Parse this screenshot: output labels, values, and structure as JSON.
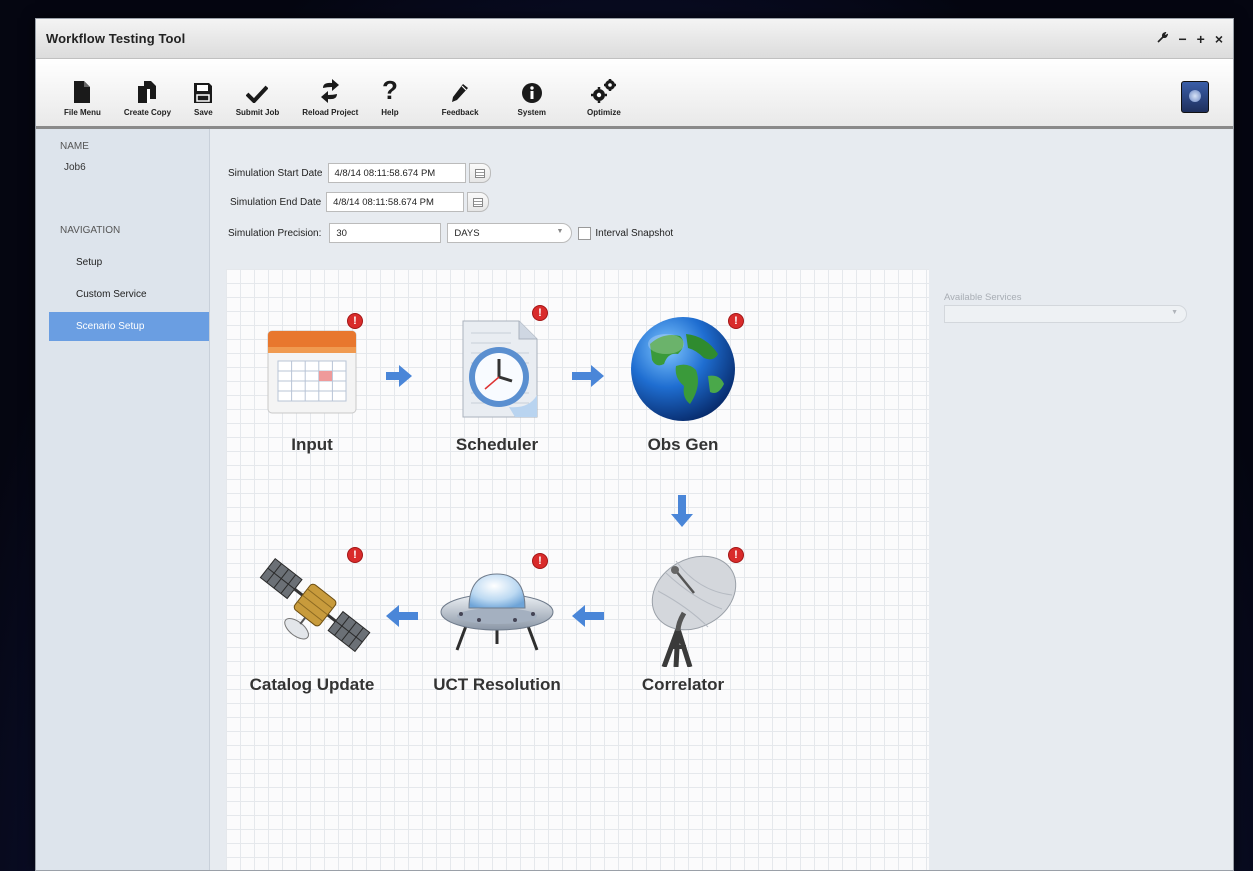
{
  "window": {
    "title": "Workflow Testing Tool",
    "controls": [
      "⁄",
      "−",
      "+",
      "×"
    ]
  },
  "toolbar": {
    "items": [
      {
        "label": "File Menu",
        "icon": "file-icon"
      },
      {
        "label": "Create Copy",
        "icon": "copy-icon"
      },
      {
        "label": "Save",
        "icon": "save-icon"
      },
      {
        "label": "Submit Job",
        "icon": "checkmark-icon"
      },
      {
        "label": "Reload Project",
        "icon": "reload-icon"
      },
      {
        "label": "Help",
        "icon": "help-icon"
      },
      {
        "label": "Feedback",
        "icon": "pencil-icon"
      },
      {
        "label": "System",
        "icon": "info-icon"
      },
      {
        "label": "Optimize",
        "icon": "gears-icon"
      }
    ]
  },
  "sidebar": {
    "name_heading": "NAME",
    "name_value": "Job6",
    "nav_heading": "NAVIGATION",
    "items": [
      {
        "label": "Setup"
      },
      {
        "label": "Custom Service"
      },
      {
        "label": "Scenario Setup"
      }
    ]
  },
  "form": {
    "start_label": "Simulation Start Date",
    "start_value": "4/8/14 08:11:58.674 PM",
    "end_label": "Simulation End Date",
    "end_value": "4/8/14 08:11:58.674 PM",
    "precision_label": "Simulation Precision:",
    "precision_value": "30",
    "unit_value": "DAYS",
    "snapshot_label": "Interval Snapshot"
  },
  "workflow": {
    "nodes": [
      {
        "label": "Input",
        "icon": "calendar-icon"
      },
      {
        "label": "Scheduler",
        "icon": "clock-document-icon"
      },
      {
        "label": "Obs Gen",
        "icon": "globe-icon"
      },
      {
        "label": "Correlator",
        "icon": "satellite-dish-icon"
      },
      {
        "label": "UCT Resolution",
        "icon": "ufo-icon"
      },
      {
        "label": "Catalog Update",
        "icon": "satellite-icon"
      }
    ],
    "badge": "!"
  },
  "services": {
    "label": "Available Services",
    "value": ""
  },
  "colors": {
    "accent": "#6a9ee2",
    "badge": "#d92b2b",
    "arrow": "#4a86d8"
  }
}
